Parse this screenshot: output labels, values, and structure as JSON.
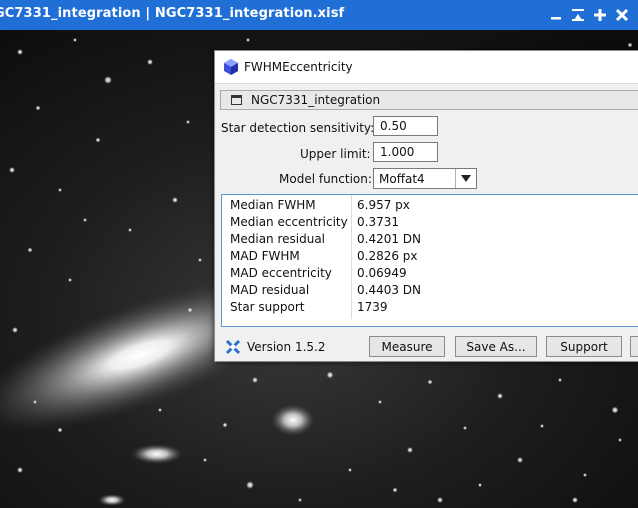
{
  "image_window": {
    "title": "GC7331_integration | NGC7331_integration.xisf",
    "controls": [
      "minimize-icon",
      "shade-icon",
      "maximize-icon",
      "close-icon"
    ]
  },
  "dialog": {
    "title": "FWHMEccentricity",
    "target_view": "NGC7331_integration",
    "form": {
      "sensitivity_label": "Star detection sensitivity:",
      "sensitivity_value": "0.50",
      "upper_limit_label": "Upper limit:",
      "upper_limit_value": "1.000",
      "model_label": "Model function:",
      "model_value": "Moffat4"
    },
    "results": [
      {
        "key": "Median FWHM",
        "value": "6.957 px"
      },
      {
        "key": "Median eccentricity",
        "value": "0.3731"
      },
      {
        "key": "Median residual",
        "value": "0.4201 DN"
      },
      {
        "key": "MAD FWHM",
        "value": "0.2826 px"
      },
      {
        "key": "MAD eccentricity",
        "value": "0.06949"
      },
      {
        "key": "MAD residual",
        "value": "0.4403 DN"
      },
      {
        "key": "Star support",
        "value": "1739"
      }
    ],
    "footer": {
      "version": "Version 1.5.2",
      "measure_label": "Measure",
      "save_as_label": "Save As...",
      "support_label": "Support"
    }
  },
  "colors": {
    "titlebar": "#1f6fd6",
    "results_border": "#5b9bd5",
    "dialog_bg": "#f0f0f0"
  }
}
